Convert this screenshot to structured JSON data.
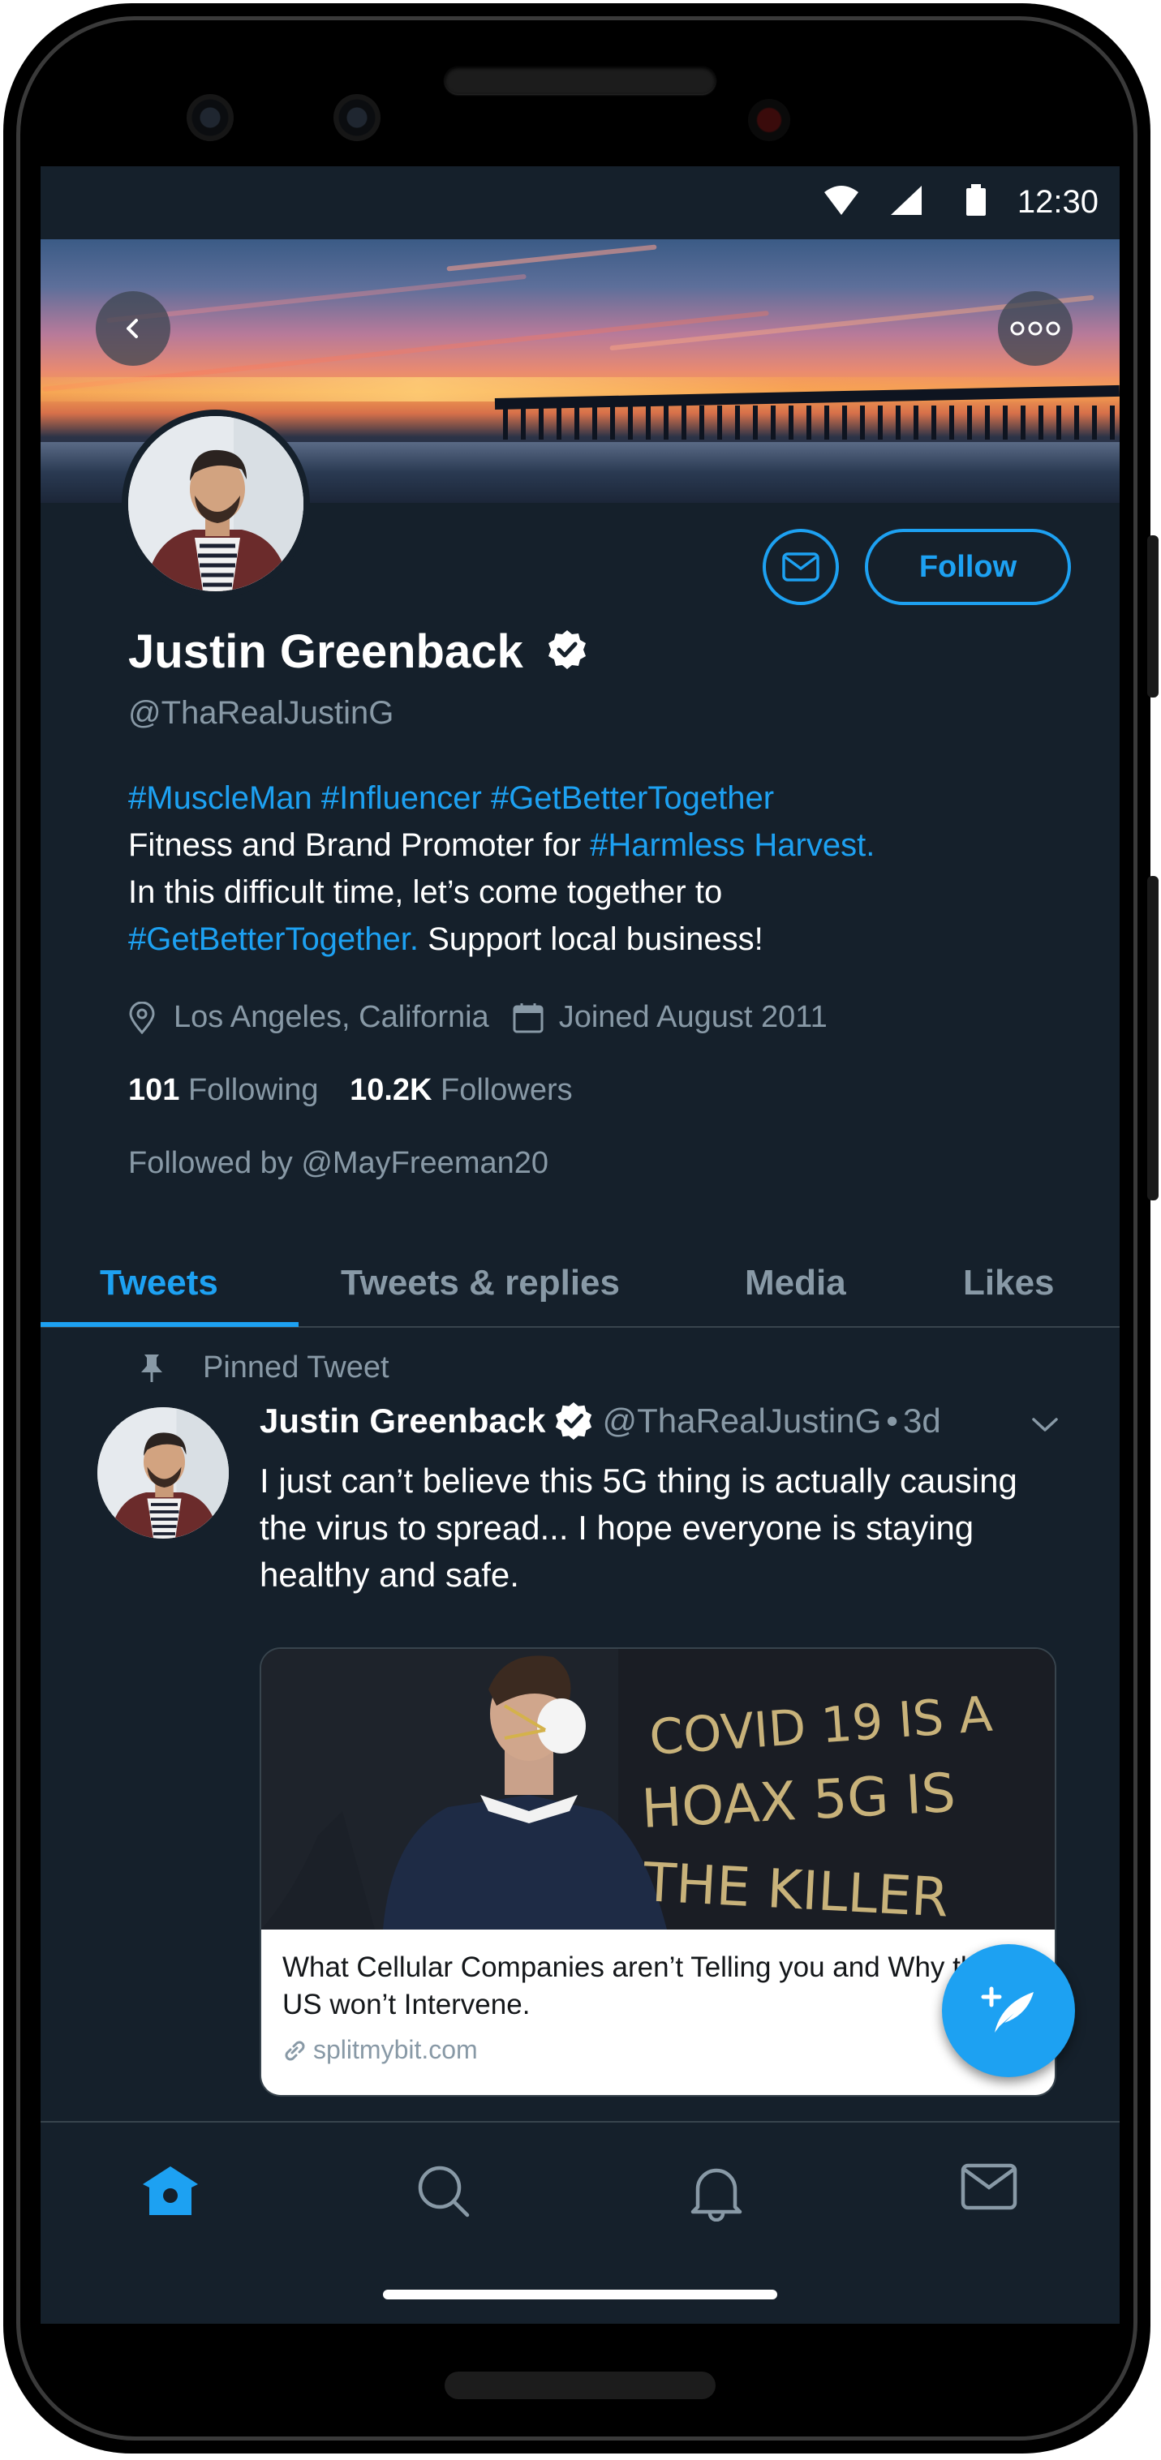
{
  "status_bar": {
    "time": "12:30",
    "icons": [
      "wifi-icon",
      "cell-signal-icon",
      "battery-icon"
    ]
  },
  "header": {
    "back_icon": "chevron-left-icon",
    "more_icon": "more-horizontal-icon"
  },
  "profile": {
    "name": "Justin Greenback",
    "verified": true,
    "handle": "@ThaRealJustinG",
    "bio": {
      "line1": [
        "#MuscleMan",
        "#Influencer",
        "#GetBetterTogether"
      ],
      "line2_text": "Fitness and Brand Promoter for ",
      "line2_tag": "#Harmless Harvest.",
      "line3_text": "In this difficult time, let’s come together to",
      "line4_tag": "#GetBetterTogether.",
      "line4_text": " Support local business!"
    },
    "location": "Los Angeles, California",
    "joined": "Joined August 2011",
    "following_count": "101",
    "following_label": "Following",
    "followers_count": "10.2K",
    "followers_label": "Followers",
    "followed_by": "Followed by @MayFreeman20",
    "follow_label": "Follow"
  },
  "tabs": [
    {
      "label": "Tweets",
      "active": true
    },
    {
      "label": "Tweets & replies",
      "active": false
    },
    {
      "label": "Media",
      "active": false
    },
    {
      "label": "Likes",
      "active": false
    }
  ],
  "tweet": {
    "pinned_label": "Pinned Tweet",
    "author": "Justin Greenback",
    "handle": "@ThaRealJustinG",
    "separator": "•",
    "age": "3d",
    "text": "I just can’t believe this 5G thing is actually causing the virus to spread... I hope everyone is staying healthy and safe.",
    "card": {
      "image_text": "COVID 19 IS A HOAX 5G IS THE KILLER",
      "title": "What Cellular Companies aren’t Telling you and Why the US won’t Intervene.",
      "domain": "splitmybit.com"
    }
  },
  "bottom_nav": [
    "home-icon",
    "search-icon",
    "notifications-icon",
    "messages-icon"
  ],
  "colors": {
    "background": "#15202b",
    "accent": "#1da1f2",
    "secondary_text": "#8899a6",
    "divider": "#38444d"
  }
}
